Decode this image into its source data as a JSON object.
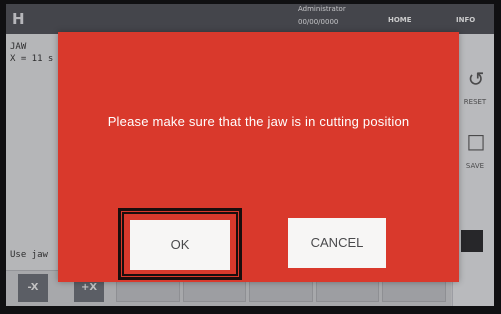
{
  "topbar": {
    "logo": "H",
    "user": "Administrator",
    "date": "00/00/0000",
    "home": "HOME",
    "info": "INFO"
  },
  "background": {
    "jaw_label": "JAW",
    "x_label": "X = 11 s",
    "use_jaw_label": "Use jaw",
    "jog_minus": "-X",
    "jog_plus": "+X"
  },
  "right_panel": {
    "reset_icon": "reset-icon",
    "reset_label": "RESET",
    "save_icon": "save-icon",
    "save_label": "SAVE"
  },
  "dialog": {
    "message": "Please make sure that the jaw is in cutting position",
    "ok_label": "OK",
    "cancel_label": "CANCEL"
  },
  "colors": {
    "dialog_bg": "#d9392c",
    "button_bg": "#f7f6f5",
    "highlight_outline": "#1a0e0d"
  }
}
